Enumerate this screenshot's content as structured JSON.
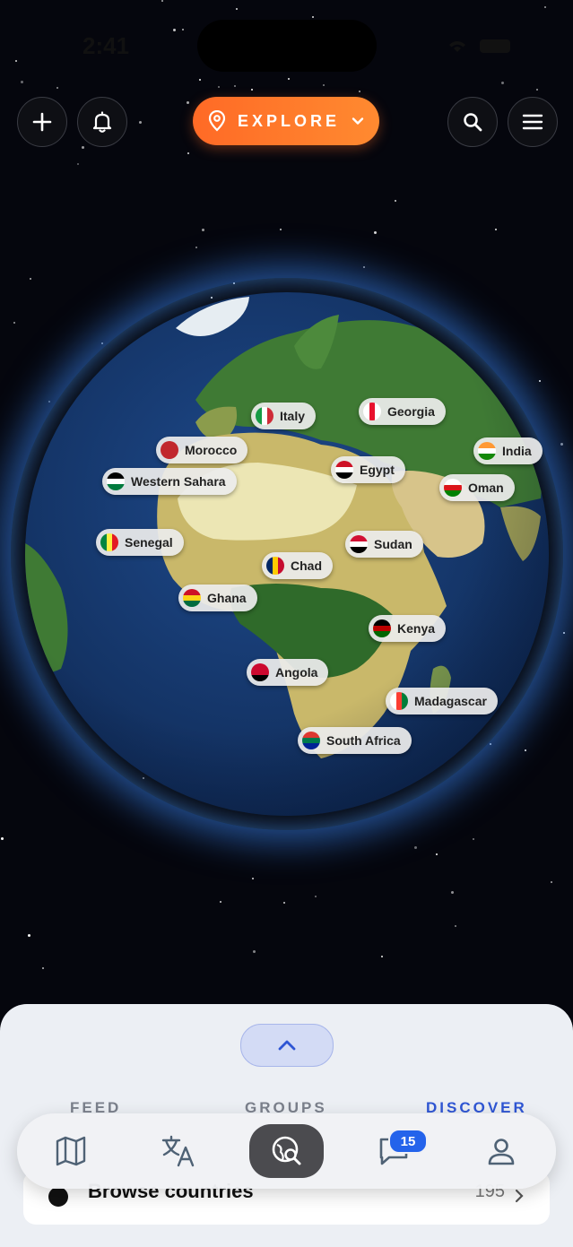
{
  "status_bar": {
    "time": "2:41"
  },
  "header": {
    "explore_label": "EXPLORE"
  },
  "countries": [
    {
      "name": "Italy",
      "flag_colors": [
        "#169b45",
        "#ffffff",
        "#ce2b37"
      ],
      "flag_dir": "h"
    },
    {
      "name": "Georgia",
      "flag_colors": [
        "#ffffff",
        "#e8112d",
        "#ffffff"
      ],
      "flag_dir": "h"
    },
    {
      "name": "Morocco",
      "flag_colors": [
        "#c1272d",
        "#c1272d",
        "#c1272d"
      ],
      "flag_dir": "h"
    },
    {
      "name": "India",
      "flag_colors": [
        "#ff9933",
        "#ffffff",
        "#138808"
      ],
      "flag_dir": "v"
    },
    {
      "name": "Western Sahara",
      "flag_colors": [
        "#000000",
        "#ffffff",
        "#007a3d"
      ],
      "flag_dir": "v"
    },
    {
      "name": "Egypt",
      "flag_colors": [
        "#ce1126",
        "#ffffff",
        "#000000"
      ],
      "flag_dir": "v"
    },
    {
      "name": "Oman",
      "flag_colors": [
        "#ffffff",
        "#db161b",
        "#008000"
      ],
      "flag_dir": "v"
    },
    {
      "name": "Senegal",
      "flag_colors": [
        "#00853f",
        "#fdef42",
        "#e31b23"
      ],
      "flag_dir": "h"
    },
    {
      "name": "Sudan",
      "flag_colors": [
        "#d21034",
        "#ffffff",
        "#000000"
      ],
      "flag_dir": "v"
    },
    {
      "name": "Chad",
      "flag_colors": [
        "#002664",
        "#fecb00",
        "#c60c30"
      ],
      "flag_dir": "h"
    },
    {
      "name": "Ghana",
      "flag_colors": [
        "#ce1126",
        "#fcd116",
        "#006b3f"
      ],
      "flag_dir": "v"
    },
    {
      "name": "Kenya",
      "flag_colors": [
        "#000000",
        "#bb0000",
        "#006600"
      ],
      "flag_dir": "v"
    },
    {
      "name": "Angola",
      "flag_colors": [
        "#cc092f",
        "#cc092f",
        "#000000"
      ],
      "flag_dir": "v"
    },
    {
      "name": "Madagascar",
      "flag_colors": [
        "#ffffff",
        "#fc3d32",
        "#007e3a"
      ],
      "flag_dir": "h"
    },
    {
      "name": "South Africa",
      "flag_colors": [
        "#de3831",
        "#007a4d",
        "#002395"
      ],
      "flag_dir": "v"
    }
  ],
  "sheet": {
    "tabs": [
      "FEED",
      "GROUPS",
      "DISCOVER"
    ],
    "active_tab": "DISCOVER",
    "browse_label": "Browse countries",
    "browse_count": "195"
  },
  "tabbar": {
    "messages_badge": "15"
  },
  "colors": {
    "accent": "#ff6a26",
    "active_tab": "#2f56d4",
    "badge": "#2463eb"
  }
}
